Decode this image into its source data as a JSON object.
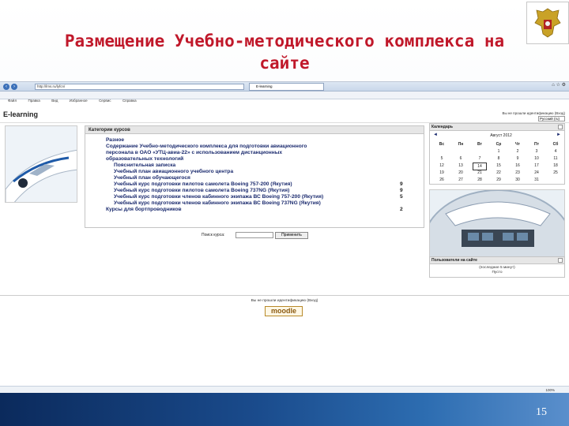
{
  "slide": {
    "title_line1": "Размещение Учебно-методического комплекса на",
    "title_line2": "сайте",
    "page_number": "15",
    "emblem_icon": "coat-of-arms-icon",
    "accent_color": "#c0182a",
    "bar_color": "#1a4b8c"
  },
  "browser": {
    "address": "http://lms.ru/lyfcn/",
    "tab_title": "E-learning",
    "menu": [
      "Файл",
      "Правка",
      "Вид",
      "Избранное",
      "Сервис",
      "Справка"
    ],
    "zoom": "100%"
  },
  "site": {
    "name": "E-learning",
    "login_status": "Вы не прошли идентификацию (Вход)",
    "language": "Русский (ru)"
  },
  "categories": {
    "header": "Категории курсов",
    "items": [
      {
        "text": "Разное",
        "count": ""
      },
      {
        "text": "Содержание Учебно-методического комплекса для подготовки авиационного",
        "count": ""
      },
      {
        "text": "персонала в ОАО «УТЦ-авиа-22» с использованием дистанционных",
        "count": ""
      },
      {
        "text": "образовательных технологий",
        "count": ""
      },
      {
        "text": "Пояснительная записка",
        "count": ""
      },
      {
        "text": "Учебный план авиационного учебного центра",
        "count": ""
      },
      {
        "text": "Учебный план обучающегося",
        "count": ""
      },
      {
        "text": "Учебный курс подготовки пилотов самолета Boeing 757-200 (Якутия)",
        "count": "9"
      },
      {
        "text": "Учебный курс подготовки пилотов самолета Boeing 737NG (Якутия)",
        "count": "9"
      },
      {
        "text": "Учебный курс подготовки членов кабинного экипажа ВС Boeing 757-200 (Якутия)",
        "count": "5"
      },
      {
        "text": "Учебный курс подготовки членов кабинного экипажа ВС Boeing 737NG (Якутия)",
        "count": ""
      },
      {
        "text": "Курсы для бортпроводников",
        "count": "2"
      }
    ],
    "search_label": "Поиск курса:",
    "search_value": "",
    "search_button": "Применить"
  },
  "calendar": {
    "title": "Календарь",
    "month": "Август 2012",
    "prev": "◄",
    "next": "►",
    "weekdays": [
      "Вс",
      "Пн",
      "Вт",
      "Ср",
      "Чт",
      "Пт",
      "Сб"
    ],
    "weeks": [
      [
        "",
        "",
        "",
        "1",
        "2",
        "3",
        "4"
      ],
      [
        "5",
        "6",
        "7",
        "8",
        "9",
        "10",
        "11"
      ],
      [
        "12",
        "13",
        "14",
        "15",
        "16",
        "17",
        "18"
      ],
      [
        "19",
        "20",
        "21",
        "22",
        "23",
        "24",
        "25"
      ],
      [
        "26",
        "27",
        "28",
        "29",
        "30",
        "31",
        ""
      ]
    ],
    "today": "14"
  },
  "users_online": {
    "title": "Пользователи на сайте",
    "period": "(последние 5 минут)",
    "status": "Пусто"
  },
  "footer": {
    "login_status": "Вы не прошли идентификацию (Вход)",
    "logo_text": "moodle"
  }
}
